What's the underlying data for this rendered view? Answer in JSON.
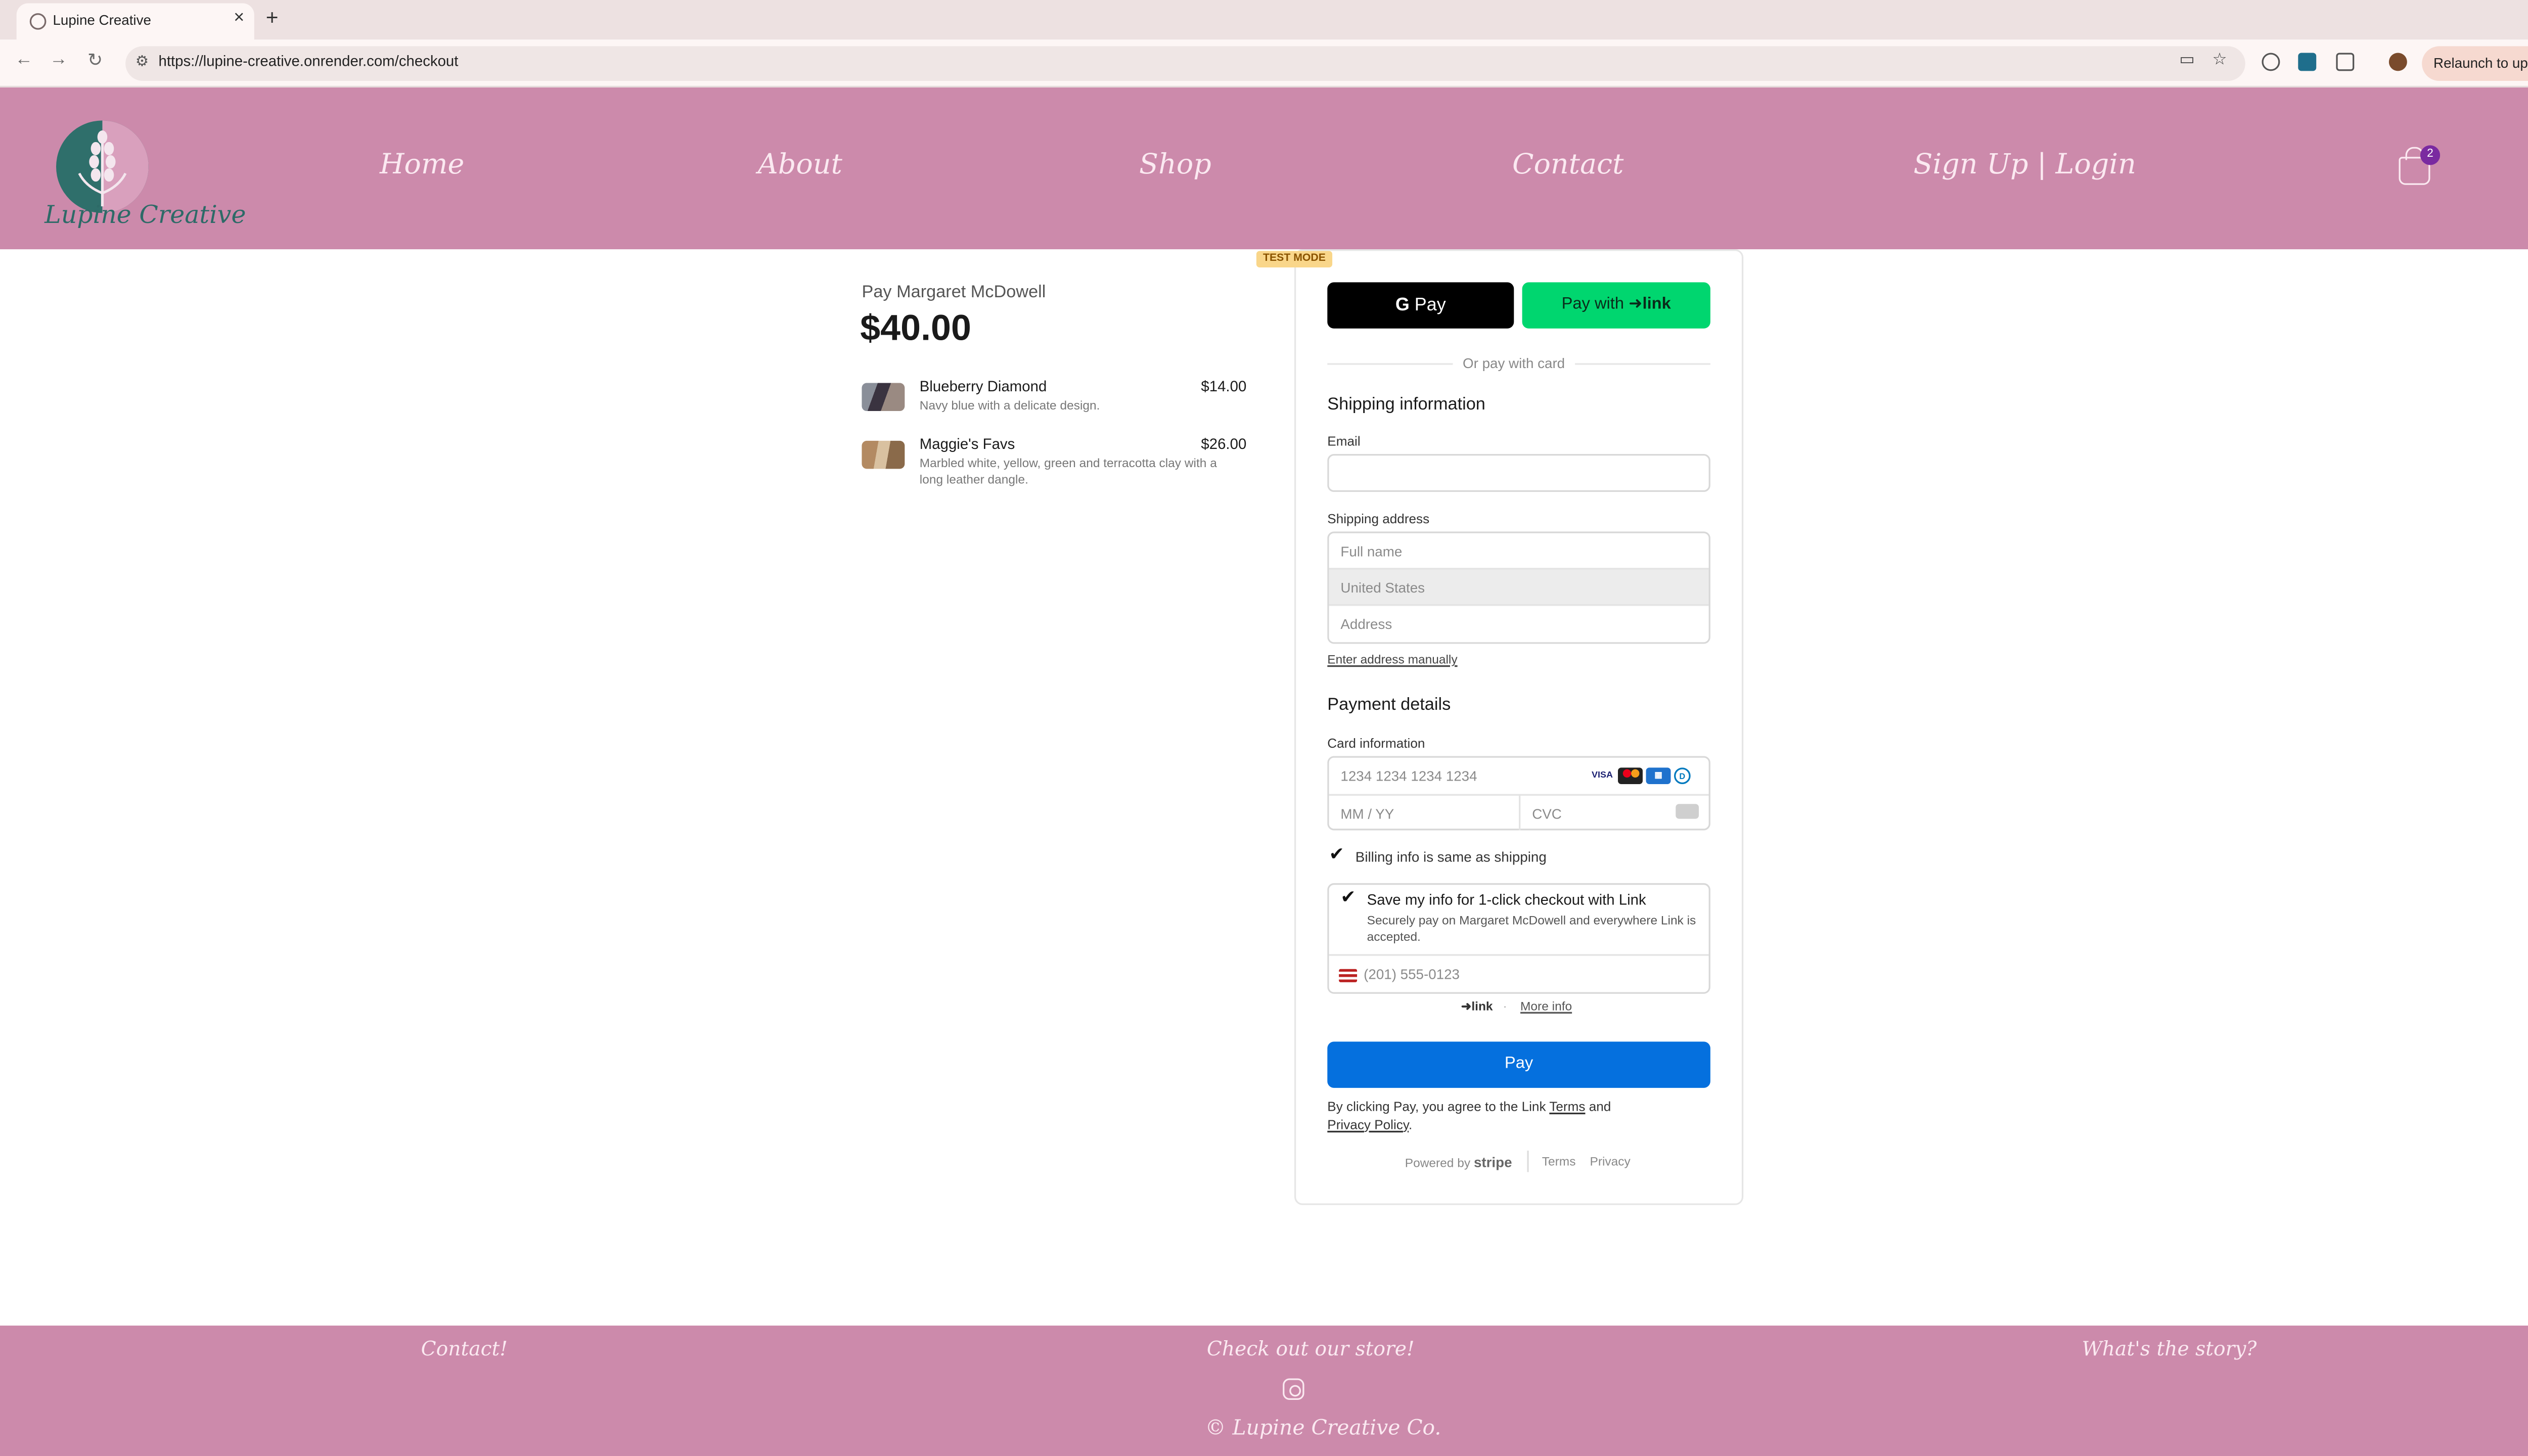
{
  "browser": {
    "tab_title": "Lupine Creative",
    "url": "https://lupine-creative.onrender.com/checkout",
    "relaunch_label": "Relaunch to update"
  },
  "site": {
    "logo_text": "Lupine Creative",
    "nav": [
      "Home",
      "About",
      "Shop",
      "Contact",
      "Sign Up | Login"
    ],
    "cart_count": "2",
    "brand_color": "#cc8aab"
  },
  "summary": {
    "pay_to": "Pay Margaret McDowell",
    "total": "$40.00",
    "items": [
      {
        "name": "Blueberry Diamond",
        "price": "$14.00",
        "desc": "Navy blue with a delicate design."
      },
      {
        "name": "Maggie's Favs",
        "price": "$26.00",
        "desc": "Marbled white, yellow, green and terracotta clay with a long leather dangle."
      }
    ]
  },
  "checkout": {
    "test_mode": "TEST MODE",
    "gpay_label": "Pay",
    "link_pay_label": "Pay with",
    "link_word": "link",
    "or_pay": "Or pay with card",
    "shipping_title": "Shipping information",
    "email_label": "Email",
    "shipping_address_label": "Shipping address",
    "full_name_ph": "Full name",
    "country_value": "United States",
    "address_ph": "Address",
    "enter_manually": "Enter address manually",
    "payment_title": "Payment details",
    "card_info_label": "Card information",
    "card_number_ph": "1234 1234 1234 1234",
    "expiry_ph": "MM / YY",
    "cvc_ph": "CVC",
    "billing_same": "Billing info is same as shipping",
    "save_title": "Save my info for 1-click checkout with Link",
    "save_desc": "Securely pay on Margaret McDowell and everywhere Link is accepted.",
    "phone_ph": "(201) 555-0123",
    "link_footer_word": "link",
    "more_info": "More info",
    "pay_button": "Pay",
    "terms_prefix": "By clicking Pay, you agree to the Link",
    "terms_link": "Terms",
    "terms_and": "and",
    "privacy_policy": "Privacy Policy",
    "powered_by": "Powered by",
    "stripe": "stripe",
    "terms": "Terms",
    "privacy": "Privacy",
    "pay_button_color": "#0570de",
    "link_color": "#00d66f"
  },
  "footer": {
    "links": [
      "Contact!",
      "Check out our store!",
      "What's the story?"
    ],
    "copyright": "© Lupine Creative Co."
  }
}
